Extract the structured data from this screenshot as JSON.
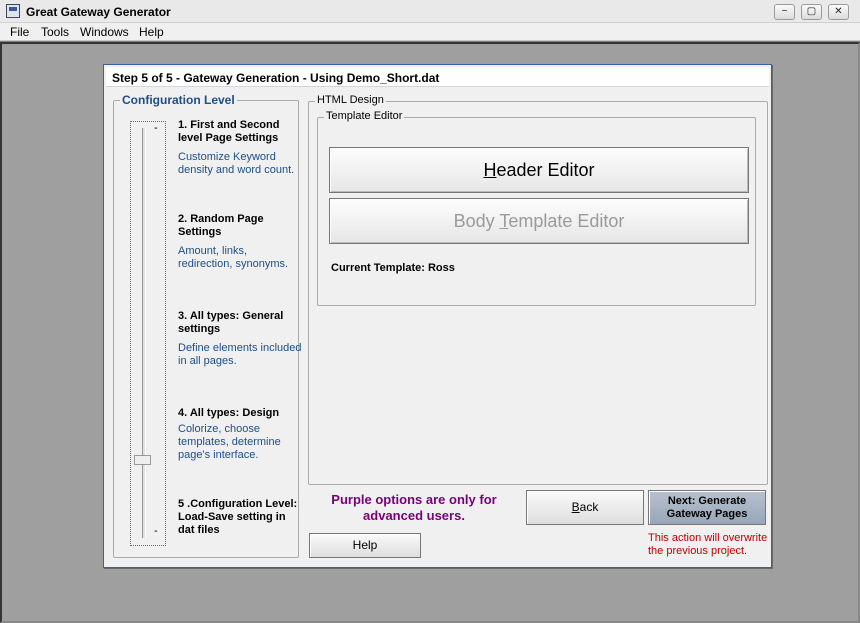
{
  "window": {
    "title": "Great Gateway Generator",
    "controls": {
      "minimize": "−",
      "restore": "▢",
      "close": "✕"
    }
  },
  "menu": {
    "items": [
      "File",
      "Tools",
      "Windows",
      "Help"
    ]
  },
  "dialog": {
    "title": "Step 5 of 5 - Gateway Generation - Using Demo_Short.dat",
    "config": {
      "legend": "Configuration Level",
      "slider_top_mark": "-",
      "slider_bottom_mark": "-",
      "steps": [
        {
          "title": "1. First and Second level Page Settings",
          "desc": "Customize Keyword density and word count."
        },
        {
          "title": "2. Random Page Settings",
          "desc": "Amount, links, redirection, synonyms."
        },
        {
          "title": "3. All types:  General settings",
          "desc": "Define elements included in all pages."
        },
        {
          "title": "4. All types: Design",
          "desc": "Colorize, choose templates, determine page's interface."
        },
        {
          "title": "5 .Configuration Level: Load-Save setting in dat files",
          "desc": ""
        }
      ]
    },
    "html_design": {
      "legend": "HTML Design",
      "template_editor": {
        "legend": "Template Editor",
        "header_editor": {
          "prefix": "",
          "accel": "H",
          "rest": "eader Editor"
        },
        "body_editor": {
          "prefix": "Body ",
          "accel": "T",
          "rest": "emplate Editor"
        },
        "current_template": "Current Template: Ross"
      }
    },
    "purple_note": "Purple options are only for advanced users.",
    "buttons": {
      "back": {
        "accel": "B",
        "rest": "ack"
      },
      "next": "Next: Generate Gateway Pages",
      "help": "Help"
    },
    "warning": "This action will overwrite the previous project."
  }
}
